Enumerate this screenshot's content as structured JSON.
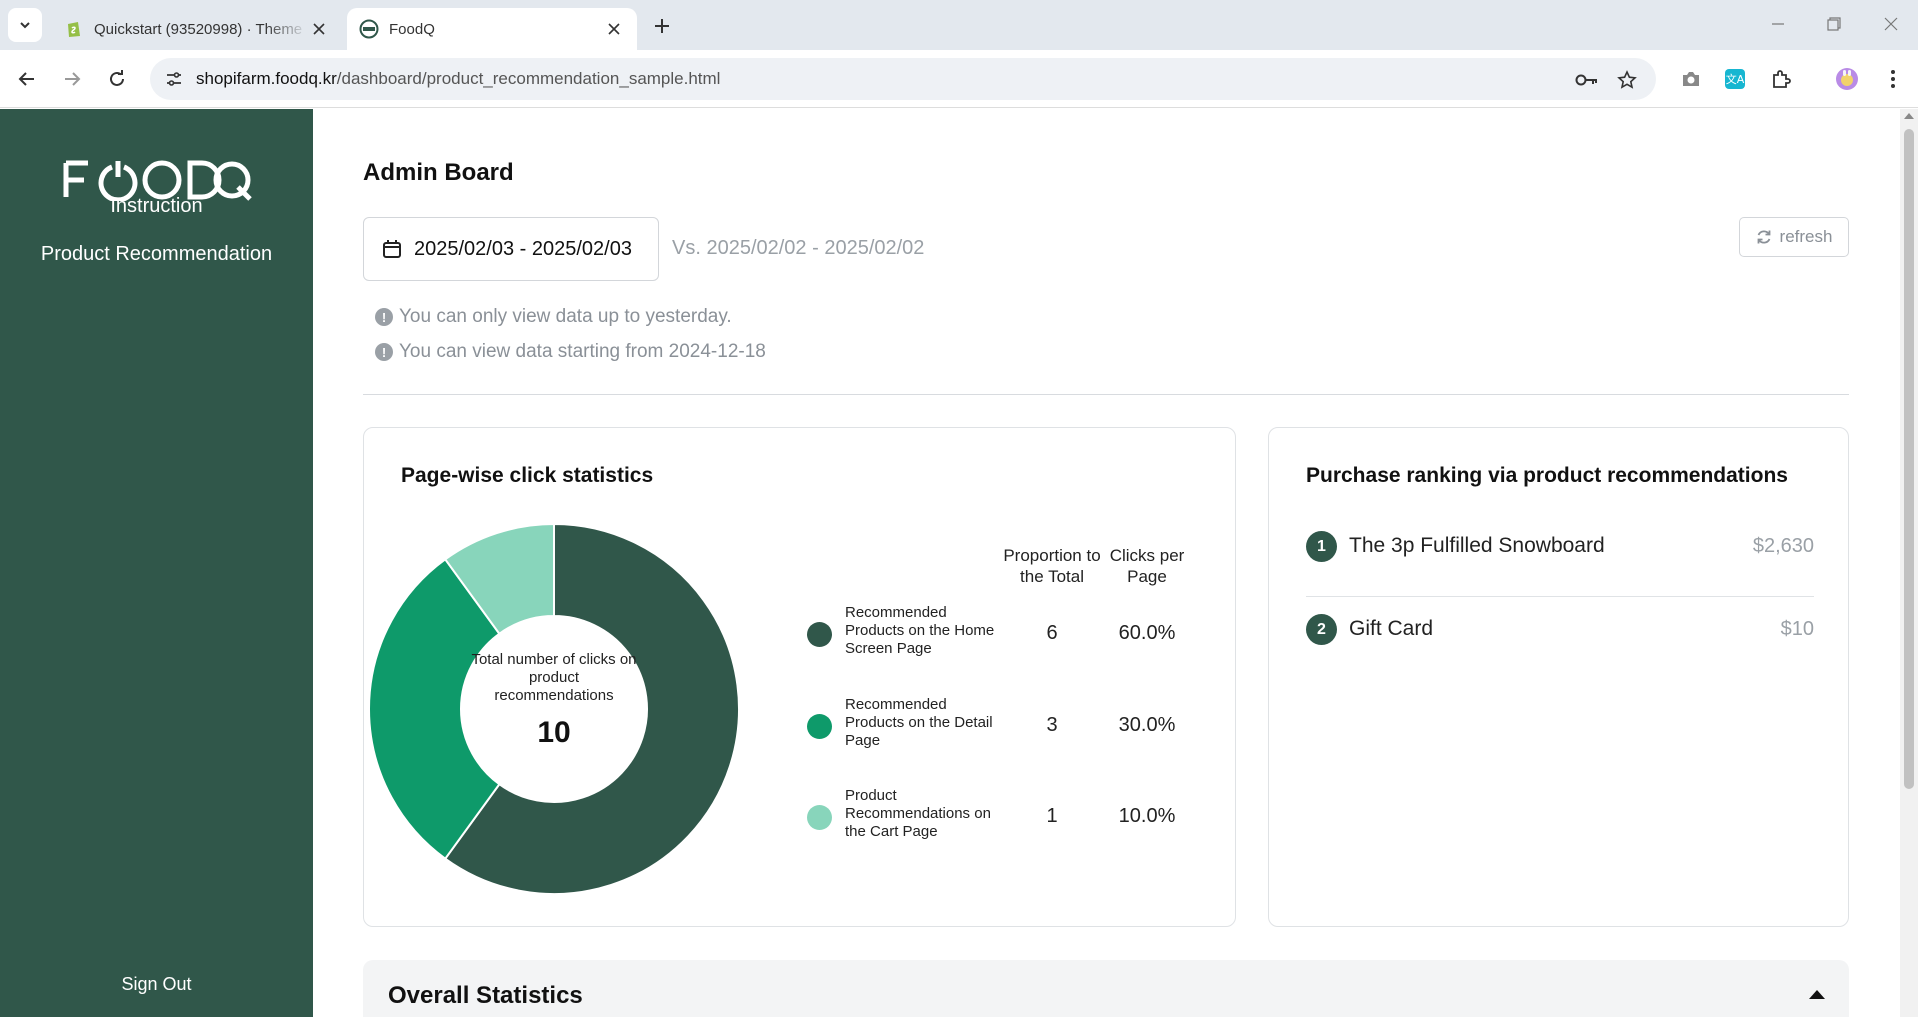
{
  "browser": {
    "tabs": [
      {
        "title": "Quickstart (93520998) · Theme",
        "active": false,
        "favicon": "shopify-icon"
      },
      {
        "title": "FoodQ",
        "active": true,
        "favicon": "foodq-icon"
      }
    ],
    "url_host": "shopifarm.foodq.kr",
    "url_path": "/dashboard/product_recommendation_sample.html"
  },
  "sidebar": {
    "logo_text": "FOODQ",
    "items": [
      {
        "label": "Instruction"
      },
      {
        "label": "Product Recommendation"
      }
    ],
    "sign_out": "Sign Out"
  },
  "header": {
    "title": "Admin Board",
    "date_range": "2025/02/03 - 2025/02/03",
    "compare_range": "Vs. 2025/02/02 - 2025/02/02",
    "refresh_label": "refresh",
    "notices": [
      "You can only view data up to yesterday.",
      "You can view data starting from 2024-12-18"
    ]
  },
  "click_stats": {
    "title": "Page-wise click statistics",
    "center_label": "Total number of clicks on product recommendations",
    "total": "10",
    "col_proportion": "Proportion to the Total",
    "col_clicks": "Clicks per Page",
    "rows": [
      {
        "label": "Recommended Products on the Home Screen Page",
        "count": "6",
        "percent": "60.0%",
        "color": "#30574a"
      },
      {
        "label": "Recommended Products on the Detail Page",
        "count": "3",
        "percent": "30.0%",
        "color": "#0e9a6a"
      },
      {
        "label": "Product Recommendations on the Cart Page",
        "count": "1",
        "percent": "10.0%",
        "color": "#88d5bb"
      }
    ]
  },
  "chart_data": {
    "type": "pie",
    "categories": [
      "Recommended Products on the Home Screen Page",
      "Recommended Products on the Detail Page",
      "Product Recommendations on the Cart Page"
    ],
    "values": [
      6,
      3,
      1
    ],
    "colors": [
      "#30574a",
      "#0e9a6a",
      "#88d5bb"
    ],
    "title": "Page-wise click statistics"
  },
  "ranking": {
    "title": "Purchase ranking via product recommendations",
    "items": [
      {
        "rank": "1",
        "name": "The 3p Fulfilled Snowboard",
        "value": "$2,630"
      },
      {
        "rank": "2",
        "name": "Gift Card",
        "value": "$10"
      }
    ]
  },
  "overall": {
    "title": "Overall Statistics"
  }
}
